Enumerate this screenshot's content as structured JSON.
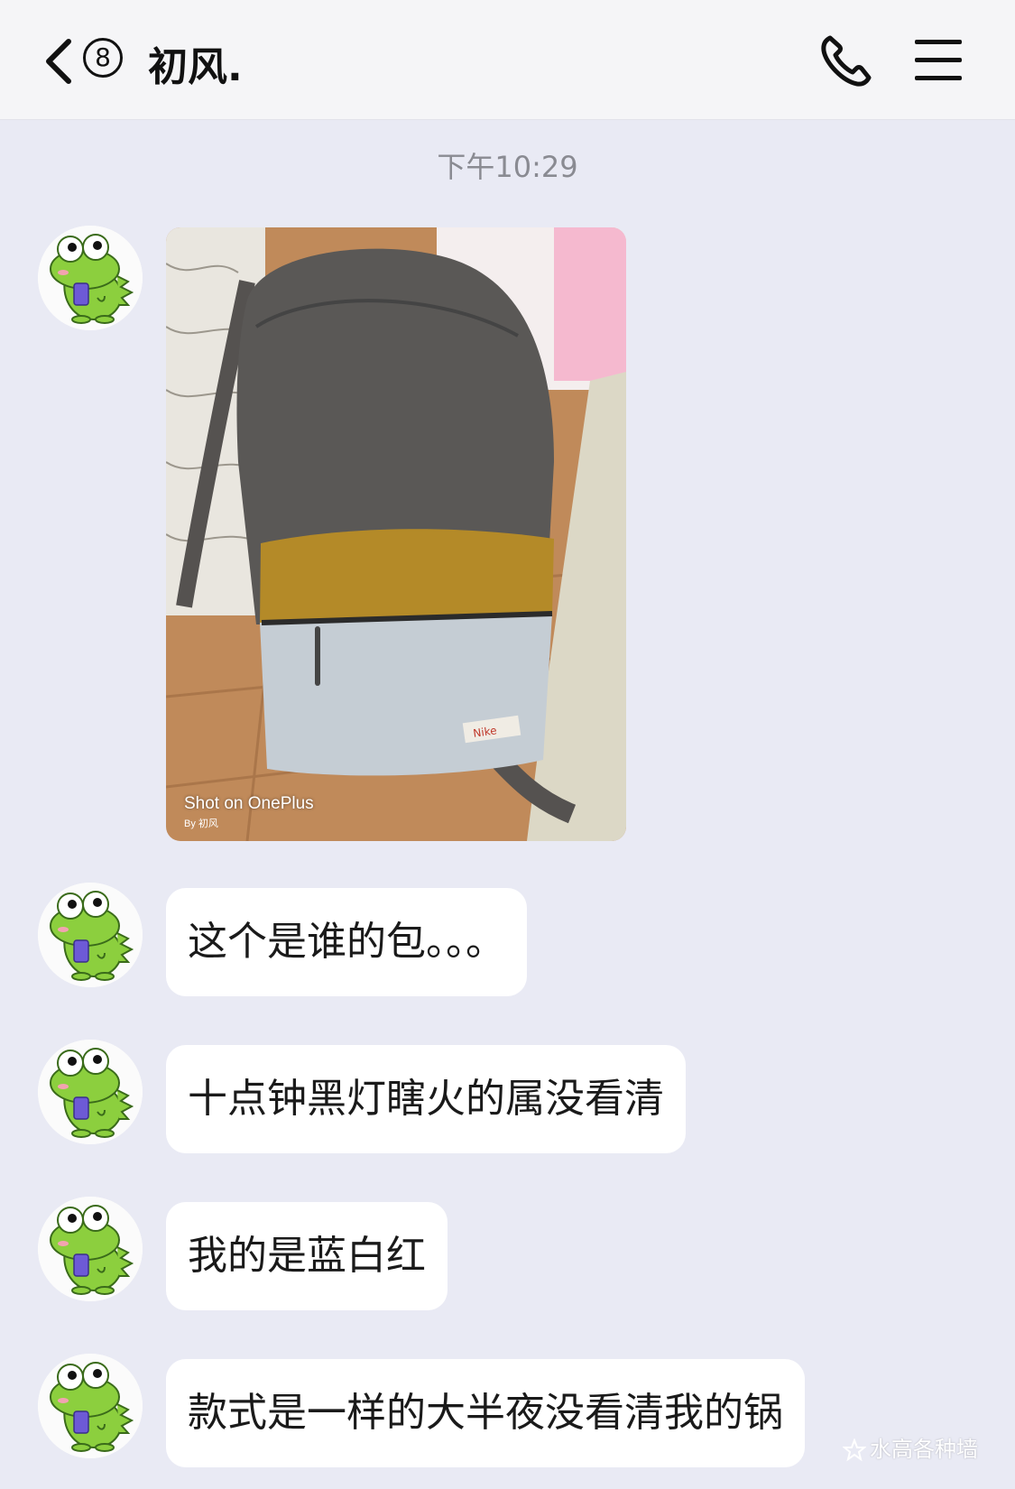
{
  "header": {
    "unread_count": "8",
    "contact_name": "初风.",
    "icons": {
      "back": "chevron-left-icon",
      "call": "phone-icon",
      "menu": "hamburger-menu-icon"
    }
  },
  "timestamp": "下午10:29",
  "image_message": {
    "caption": "Shot on OnePlus",
    "caption_sub": "By 初风"
  },
  "messages": [
    {
      "text": "这个是谁的包。。。"
    },
    {
      "text": "十点钟黑灯瞎火的属没看清"
    },
    {
      "text": "我的是蓝白红"
    },
    {
      "text": "款式是一样的大半夜没看清我的锅"
    }
  ],
  "watermark": "水高各种墙",
  "colors": {
    "background": "#e9eaf4",
    "header_bg": "#f5f5f7",
    "bubble": "#ffffff",
    "avatar_green": "#8ccf3e"
  }
}
